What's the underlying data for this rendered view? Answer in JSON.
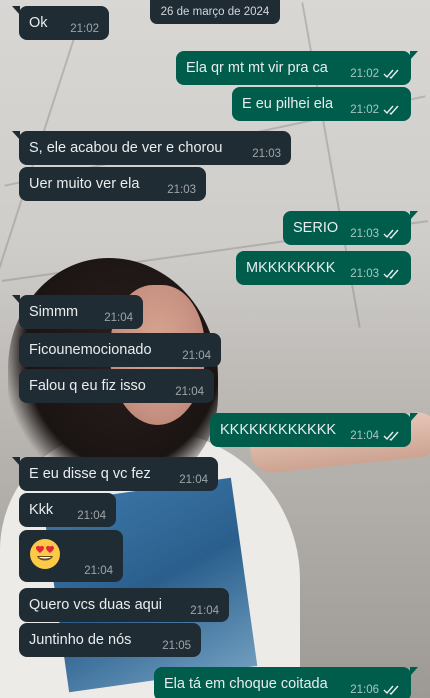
{
  "date_chip": "26 de março de 2024",
  "messages": [
    {
      "dir": "in",
      "text": "Ok",
      "time": "21:02"
    },
    {
      "dir": "out",
      "text": "Ela qr mt mt vir pra ca",
      "time": "21:02"
    },
    {
      "dir": "out",
      "text": "E eu pilhei ela",
      "time": "21:02"
    },
    {
      "dir": "in",
      "text": "S, ele acabou de ver e chorou",
      "time": "21:03"
    },
    {
      "dir": "in",
      "text": "Uer muito ver ela",
      "time": "21:03"
    },
    {
      "dir": "out",
      "text": "SERIO",
      "time": "21:03"
    },
    {
      "dir": "out",
      "text": "MKKKKKKKK",
      "time": "21:03"
    },
    {
      "dir": "in",
      "text": "Simmm",
      "time": "21:04"
    },
    {
      "dir": "in",
      "text": "Ficounemocionado",
      "time": "21:04"
    },
    {
      "dir": "in",
      "text": "Falou q eu fiz isso",
      "time": "21:04"
    },
    {
      "dir": "out",
      "text": "KKKKKKKKKKKK",
      "time": "21:04"
    },
    {
      "dir": "in",
      "text": "E eu disse q vc fez",
      "time": "21:04"
    },
    {
      "dir": "in",
      "text": "Kkk",
      "time": "21:04"
    },
    {
      "dir": "in",
      "emoji": "heart-eyes-emoji",
      "time": "21:04"
    },
    {
      "dir": "in",
      "text": "Quero vcs duas aqui",
      "time": "21:04"
    },
    {
      "dir": "in",
      "text": "Juntinho de nós",
      "time": "21:05"
    },
    {
      "dir": "out",
      "text": "Ela tá em choque coitada",
      "time": "21:06"
    }
  ],
  "colors": {
    "incoming_bubble": "#202c33",
    "outgoing_bubble": "#005c4b",
    "read_ticks": "#e9edef"
  }
}
